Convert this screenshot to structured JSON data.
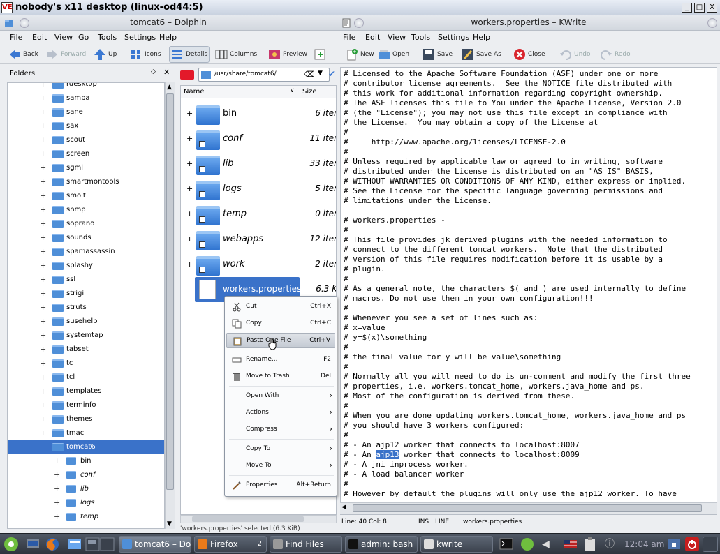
{
  "vnc": {
    "title": "nobody's x11 desktop (linux-od44:5)",
    "logo": "VE",
    "buttons": [
      "_",
      "□",
      "X"
    ]
  },
  "dolphin": {
    "title": "tomcat6 – Dolphin",
    "menu": [
      "File",
      "Edit",
      "View",
      "Go",
      "Tools",
      "Settings",
      "Help"
    ],
    "toolbar": {
      "back": "Back",
      "forward": "Forward",
      "up": "Up",
      "icons": "Icons",
      "details": "Details",
      "columns": "Columns",
      "preview": "Preview"
    },
    "folders_panel": {
      "title": "Folders"
    },
    "tree": [
      "rdesktop",
      "samba",
      "sane",
      "sax",
      "scout",
      "screen",
      "sgml",
      "smartmontools",
      "smolt",
      "snmp",
      "soprano",
      "sounds",
      "spamassassin",
      "splashy",
      "ssl",
      "strigi",
      "struts",
      "susehelp",
      "systemtap",
      "tabset",
      "tc",
      "tcl",
      "templates",
      "terminfo",
      "themes",
      "tmac",
      "tomcat6"
    ],
    "tree_selected": "tomcat6",
    "tree_children": [
      "bin",
      "conf",
      "lib",
      "logs",
      "temp"
    ],
    "location": "/usr/share/tomcat6/",
    "columns": {
      "name": "Name",
      "size": "Size"
    },
    "files": [
      {
        "name": "bin",
        "size": "6 iter"
      },
      {
        "name": "conf",
        "size": "11 iter"
      },
      {
        "name": "lib",
        "size": "33 iter"
      },
      {
        "name": "logs",
        "size": "5 iter"
      },
      {
        "name": "temp",
        "size": "0 iter"
      },
      {
        "name": "webapps",
        "size": "12 iter"
      },
      {
        "name": "work",
        "size": "2 iter"
      },
      {
        "name": "workers.properties",
        "size": "6.3 K"
      }
    ],
    "status": "'workers.properties' selected (6.3 KiB)"
  },
  "context_menu": {
    "items": [
      {
        "label": "Cut",
        "shortcut": "Ctrl+X",
        "icon": "scissors-icon"
      },
      {
        "label": "Copy",
        "shortcut": "Ctrl+C",
        "icon": "copy-icon"
      },
      {
        "label": "Paste One File",
        "shortcut": "Ctrl+V",
        "icon": "paste-icon"
      },
      {
        "label": "Rename...",
        "shortcut": "F2",
        "icon": "rename-icon"
      },
      {
        "label": "Move to Trash",
        "shortcut": "Del",
        "icon": "trash-icon"
      },
      {
        "label": "Open With",
        "shortcut": "",
        "icon": ""
      },
      {
        "label": "Actions",
        "shortcut": "",
        "icon": ""
      },
      {
        "label": "Compress",
        "shortcut": "",
        "icon": ""
      },
      {
        "label": "Copy To",
        "shortcut": "",
        "icon": ""
      },
      {
        "label": "Move To",
        "shortcut": "",
        "icon": ""
      },
      {
        "label": "Properties",
        "shortcut": "Alt+Return",
        "icon": "properties-icon"
      }
    ]
  },
  "kwrite": {
    "title": "workers.properties – KWrite",
    "menu": [
      "File",
      "Edit",
      "View",
      "Tools",
      "Settings",
      "Help"
    ],
    "toolbar": {
      "new": "New",
      "open": "Open",
      "save": "Save",
      "save_as": "Save As",
      "close": "Close",
      "undo": "Undo",
      "redo": "Redo"
    },
    "lines": [
      "# Licensed to the Apache Software Foundation (ASF) under one or more",
      "# contributor license agreements.  See the NOTICE file distributed with",
      "# this work for additional information regarding copyright ownership.",
      "# The ASF licenses this file to You under the Apache License, Version 2.0",
      "# (the \"License\"); you may not use this file except in compliance with",
      "# the License.  You may obtain a copy of the License at",
      "#",
      "#     http://www.apache.org/licenses/LICENSE-2.0",
      "#",
      "# Unless required by applicable law or agreed to in writing, software",
      "# distributed under the License is distributed on an \"AS IS\" BASIS,",
      "# WITHOUT WARRANTIES OR CONDITIONS OF ANY KIND, either express or implied.",
      "# See the License for the specific language governing permissions and",
      "# limitations under the License.",
      "",
      "# workers.properties -",
      "#",
      "# This file provides jk derived plugins with the needed information to",
      "# connect to the different tomcat workers.  Note that the distributed",
      "# version of this file requires modification before it is usable by a",
      "# plugin.",
      "#",
      "# As a general note, the characters $( and ) are used internally to define",
      "# macros. Do not use them in your own configuration!!!",
      "#",
      "# Whenever you see a set of lines such as:",
      "# x=value",
      "# y=$(x)\\something",
      "#",
      "# the final value for y will be value\\something",
      "#",
      "# Normally all you will need to do is un-comment and modify the first three",
      "# properties, i.e. workers.tomcat_home, workers.java_home and ps.",
      "# Most of the configuration is derived from these.",
      "#",
      "# When you are done updating workers.tomcat_home, workers.java_home and ps",
      "# you should have 3 workers configured:",
      "#",
      "# - An ajp12 worker that connects to localhost:8007",
      "# - An ",
      "# - A jni inprocess worker.",
      "# - A load balancer worker",
      "#",
      "# However by default the plugins will only use the ajp12 worker. To have"
    ],
    "line40_selected": "ajp13",
    "line40_rest": " worker that connects to localhost:8009",
    "status": {
      "pos": "Line: 40 Col: 8",
      "ins": "INS",
      "line": "LINE",
      "file": "workers.properties"
    }
  },
  "taskbar": {
    "tasks": [
      {
        "label": "tomcat6 – Do",
        "active": true
      },
      {
        "label": "Firefox",
        "active": false
      },
      {
        "label": "Find Files",
        "active": false
      },
      {
        "label": "admin: bash",
        "active": false
      },
      {
        "label": "kwrite",
        "active": false
      }
    ],
    "firefox_count": "2",
    "clock": "12:04 am"
  }
}
